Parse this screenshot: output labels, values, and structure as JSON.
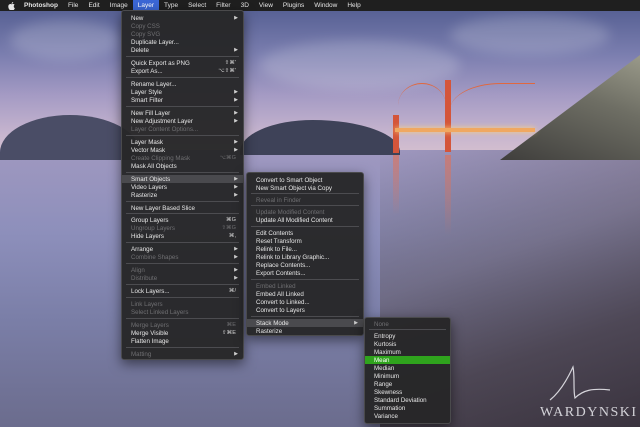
{
  "menubar": {
    "items": [
      "Photoshop",
      "File",
      "Edit",
      "Image",
      "Layer",
      "Type",
      "Select",
      "Filter",
      "3D",
      "View",
      "Plugins",
      "Window",
      "Help"
    ]
  },
  "layer_menu": {
    "items": [
      {
        "label": "New",
        "sub": true
      },
      {
        "label": "Copy CSS",
        "disabled": true
      },
      {
        "label": "Copy SVG",
        "disabled": true
      },
      {
        "label": "Duplicate Layer..."
      },
      {
        "label": "Delete",
        "sub": true
      },
      {
        "label": "Quick Export as PNG",
        "shortcut": "⇧⌘'"
      },
      {
        "label": "Export As...",
        "shortcut": "⌥⇧⌘'"
      },
      {
        "label": "Rename Layer..."
      },
      {
        "label": "Layer Style",
        "sub": true
      },
      {
        "label": "Smart Filter",
        "sub": true
      },
      {
        "label": "New Fill Layer",
        "sub": true
      },
      {
        "label": "New Adjustment Layer",
        "sub": true
      },
      {
        "label": "Layer Content Options...",
        "disabled": true
      },
      {
        "label": "Layer Mask",
        "sub": true
      },
      {
        "label": "Vector Mask",
        "sub": true
      },
      {
        "label": "Create Clipping Mask",
        "shortcut": "⌥⌘G",
        "disabled": true
      },
      {
        "label": "Mask All Objects"
      },
      {
        "label": "Smart Objects",
        "sub": true,
        "highlighted": true
      },
      {
        "label": "Video Layers",
        "sub": true
      },
      {
        "label": "Rasterize",
        "sub": true
      },
      {
        "label": "New Layer Based Slice"
      },
      {
        "label": "Group Layers",
        "shortcut": "⌘G"
      },
      {
        "label": "Ungroup Layers",
        "shortcut": "⇧⌘G",
        "disabled": true
      },
      {
        "label": "Hide Layers",
        "shortcut": "⌘,"
      },
      {
        "label": "Arrange",
        "sub": true
      },
      {
        "label": "Combine Shapes",
        "sub": true,
        "disabled": true
      },
      {
        "label": "Align",
        "sub": true,
        "disabled": true
      },
      {
        "label": "Distribute",
        "sub": true,
        "disabled": true
      },
      {
        "label": "Lock Layers...",
        "shortcut": "⌘/"
      },
      {
        "label": "Link Layers",
        "disabled": true
      },
      {
        "label": "Select Linked Layers",
        "disabled": true
      },
      {
        "label": "Merge Layers",
        "shortcut": "⌘E",
        "disabled": true
      },
      {
        "label": "Merge Visible",
        "shortcut": "⇧⌘E"
      },
      {
        "label": "Flatten Image"
      },
      {
        "label": "Matting",
        "sub": true,
        "disabled": true
      }
    ]
  },
  "smart_objects_menu": {
    "items": [
      {
        "label": "Convert to Smart Object"
      },
      {
        "label": "New Smart Object via Copy"
      },
      {
        "label": "Reveal in Finder",
        "disabled": true
      },
      {
        "label": "Update Modified Content",
        "disabled": true
      },
      {
        "label": "Update All Modified Content"
      },
      {
        "label": "Edit Contents"
      },
      {
        "label": "Reset Transform"
      },
      {
        "label": "Relink to File..."
      },
      {
        "label": "Relink to Library Graphic..."
      },
      {
        "label": "Replace Contents..."
      },
      {
        "label": "Export Contents..."
      },
      {
        "label": "Embed Linked",
        "disabled": true
      },
      {
        "label": "Embed All Linked"
      },
      {
        "label": "Convert to Linked..."
      },
      {
        "label": "Convert to Layers"
      },
      {
        "label": "Stack Mode",
        "sub": true,
        "highlighted": true
      },
      {
        "label": "Rasterize"
      }
    ]
  },
  "stack_mode_menu": {
    "items": [
      {
        "label": "None",
        "disabled": true
      },
      {
        "label": "Entropy"
      },
      {
        "label": "Kurtosis"
      },
      {
        "label": "Maximum"
      },
      {
        "label": "Mean",
        "selected": true
      },
      {
        "label": "Median"
      },
      {
        "label": "Minimum"
      },
      {
        "label": "Range"
      },
      {
        "label": "Skewness"
      },
      {
        "label": "Standard Deviation"
      },
      {
        "label": "Summation"
      },
      {
        "label": "Variance"
      }
    ]
  },
  "watermark": {
    "text": "WARDYNSKI"
  },
  "colors": {
    "menubar": "#1f1f1f",
    "menu_active": "#3b67d6",
    "menu_bg": "#262628",
    "selected": "#2fa31d"
  }
}
